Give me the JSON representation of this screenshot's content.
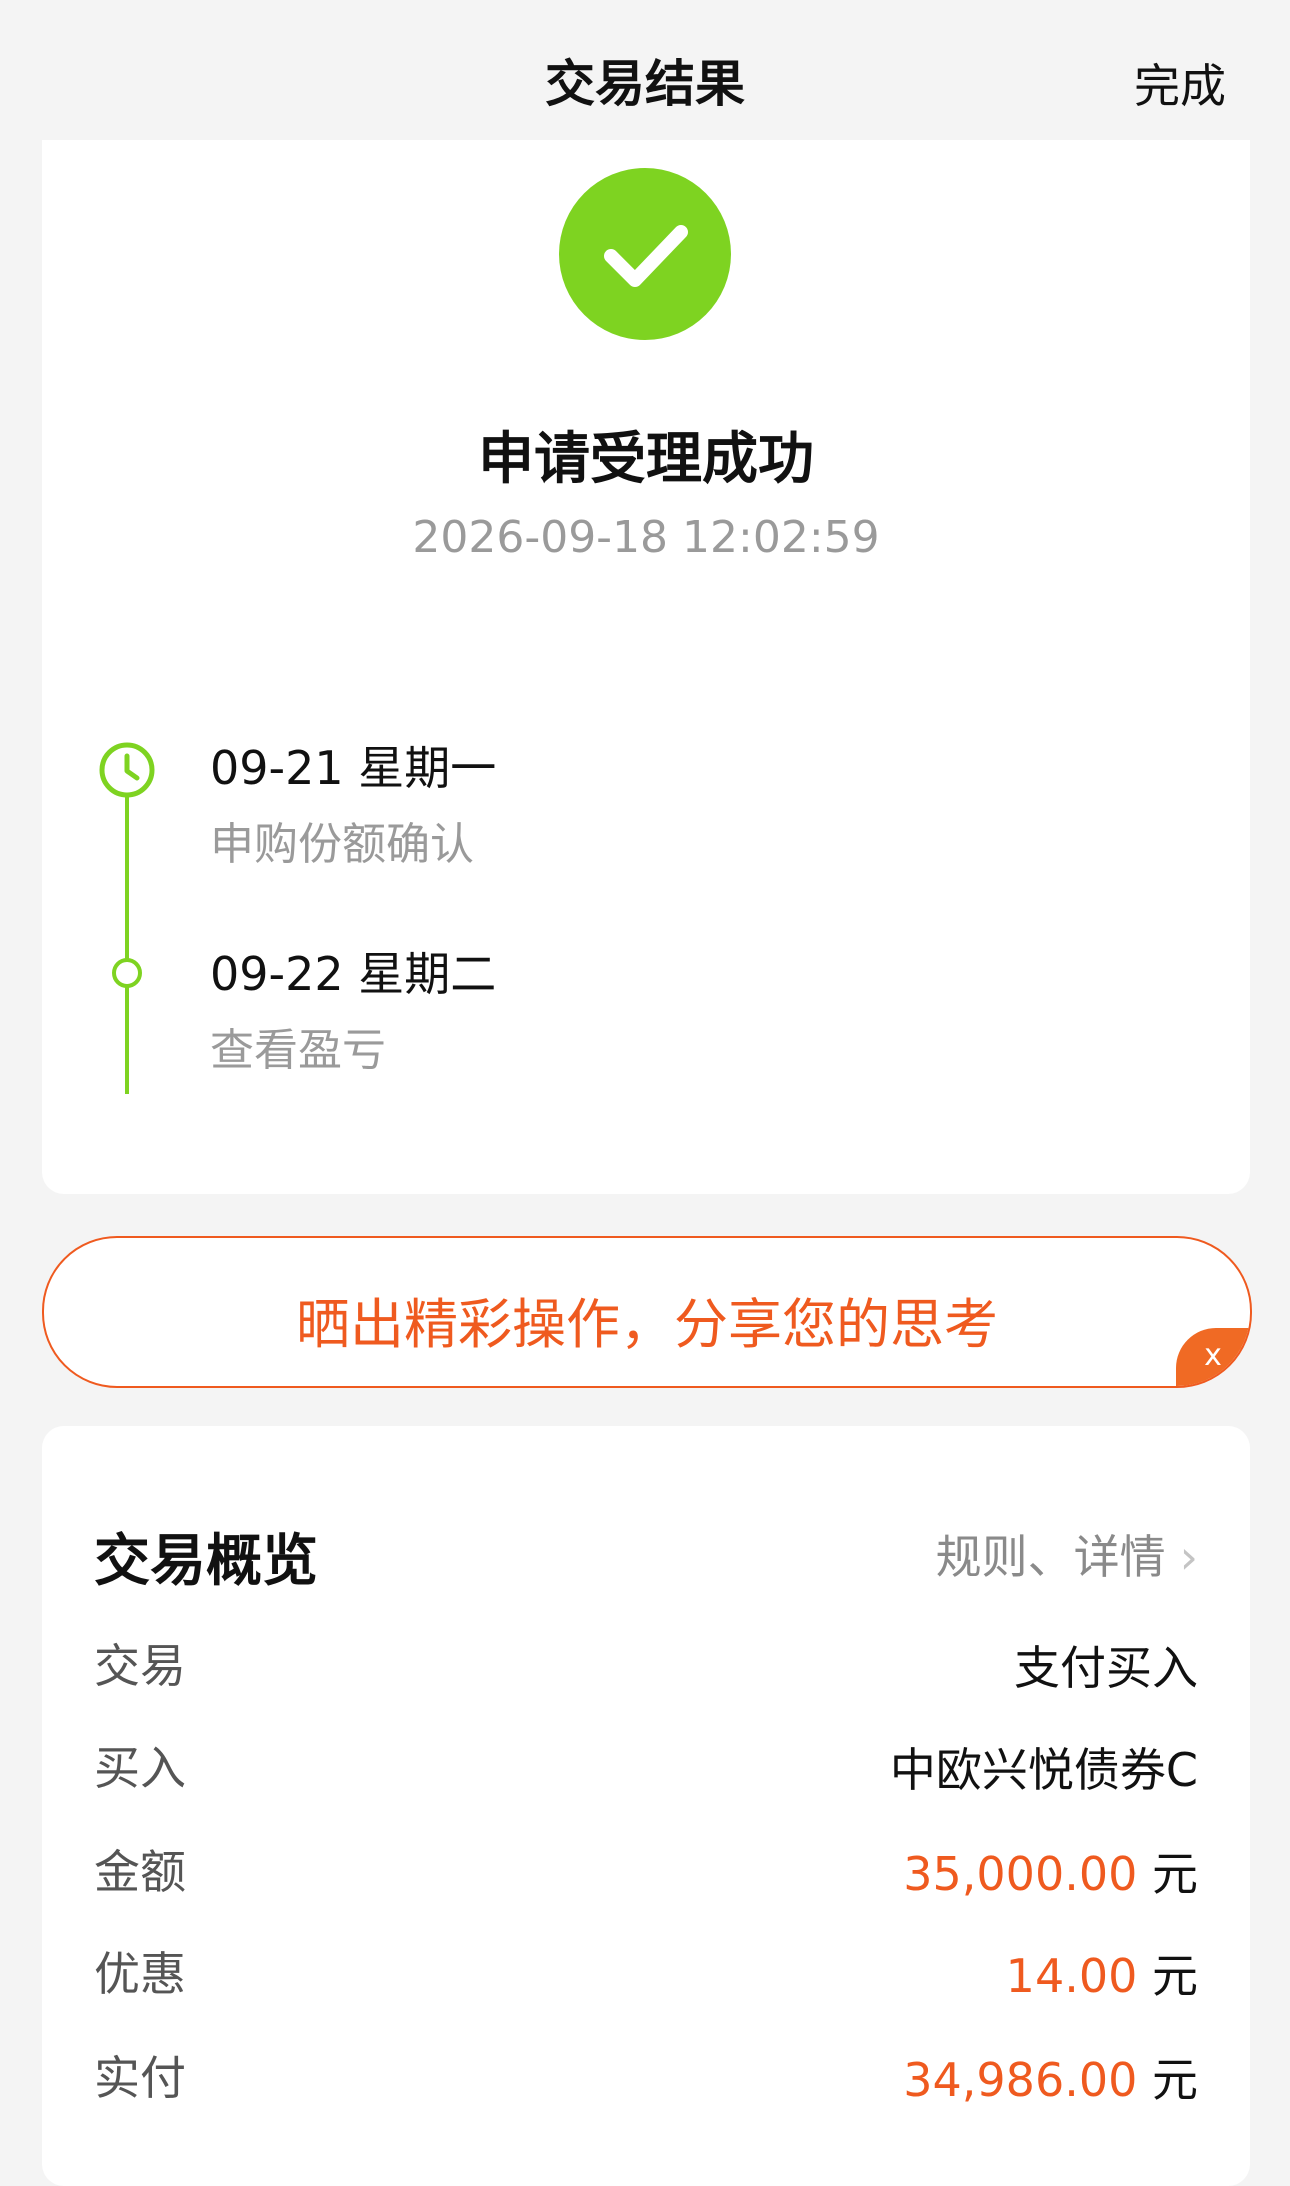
{
  "header": {
    "title": "交易结果",
    "done_label": "完成"
  },
  "result": {
    "icon": "check-circle-icon",
    "title": "申请受理成功",
    "timestamp": "2026-09-18 12:02:59",
    "timeline": [
      {
        "date": "09-21  星期一",
        "desc": "申购份额确认",
        "icon": "clock-icon"
      },
      {
        "date": "09-22  星期二",
        "desc": "查看盈亏",
        "icon": "dot-icon"
      }
    ]
  },
  "share": {
    "text": "晒出精彩操作，分享您的思考",
    "close_label": "x"
  },
  "overview": {
    "title": "交易概览",
    "link_label": "规则、详情",
    "rows": [
      {
        "label": "交易",
        "value": "支付买入",
        "unit": ""
      },
      {
        "label": "买入",
        "value": "中欧兴悦债券C",
        "unit": ""
      },
      {
        "label": "金额",
        "value": "35,000.00",
        "unit": "元"
      },
      {
        "label": "优惠",
        "value": "14.00",
        "unit": "元"
      },
      {
        "label": "实付",
        "value": "34,986.00",
        "unit": "元"
      }
    ]
  },
  "colors": {
    "accent_green": "#7ed321",
    "accent_orange": "#ef5a1f"
  }
}
